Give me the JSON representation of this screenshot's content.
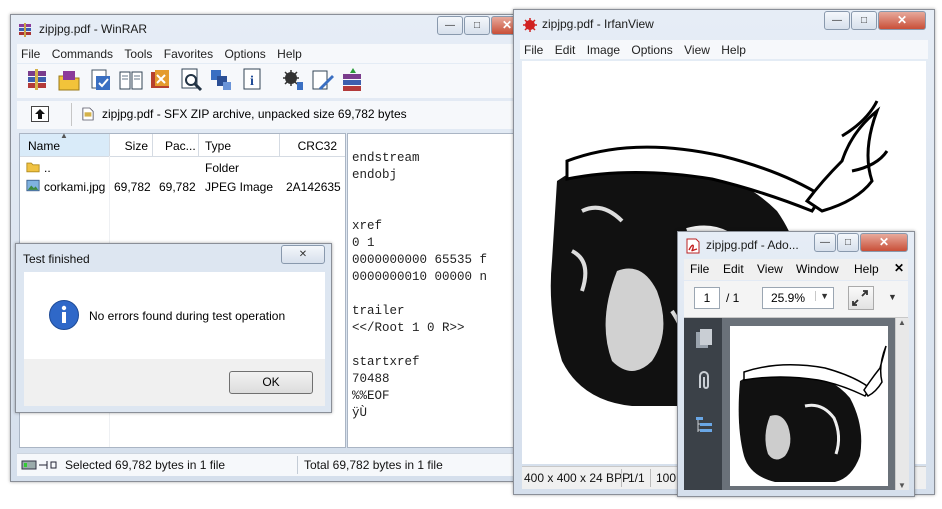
{
  "winrar": {
    "title": "zipjpg.pdf - WinRAR",
    "menu": [
      "File",
      "Commands",
      "Tools",
      "Favorites",
      "Options",
      "Help"
    ],
    "toolbar_icons": [
      "add-icon",
      "extract-icon",
      "test-icon",
      "view-icon",
      "delete-icon",
      "find-icon",
      "wizard-icon",
      "info-icon",
      "virus-scan-icon",
      "comment-icon",
      "sfx-icon"
    ],
    "path": "zipjpg.pdf - SFX ZIP archive, unpacked size 69,782 bytes",
    "columns": {
      "name": "Name",
      "size": "Size",
      "packed": "Pac...",
      "type": "Type",
      "crc": "CRC32"
    },
    "rows": [
      {
        "name": "..",
        "size": "",
        "packed": "",
        "type": "Folder",
        "crc": ""
      },
      {
        "name": "corkami.jpg",
        "size": "69,782",
        "packed": "69,782",
        "type": "JPEG Image",
        "crc": "2A142635"
      }
    ],
    "comment_lines": [
      "endstream",
      "endobj",
      "",
      "",
      "xref",
      "0 1",
      "0000000000 65535 f",
      "0000000010 00000 n",
      "",
      "trailer",
      "<</Root 1 0 R>>",
      "",
      "startxref",
      "70488",
      "%%EOF",
      "ÿÙ"
    ],
    "status_left": "Selected 69,782 bytes in 1 file",
    "status_right": "Total 69,782 bytes in 1 file"
  },
  "dialog": {
    "title": "Test finished",
    "message": "No errors found during test operation",
    "ok_label": "OK"
  },
  "irfan": {
    "title": "zipjpg.pdf - IrfanView",
    "menu": [
      "File",
      "Edit",
      "Image",
      "Options",
      "View",
      "Help"
    ],
    "status": [
      "400 x 400 x 24 BPP",
      "1/1",
      "100"
    ]
  },
  "adobe": {
    "title": "zipjpg.pdf - Ado...",
    "menu": [
      "File",
      "Edit",
      "View",
      "Window",
      "Help"
    ],
    "page_current": "1",
    "page_total": "/ 1",
    "zoom": "25.9%"
  }
}
